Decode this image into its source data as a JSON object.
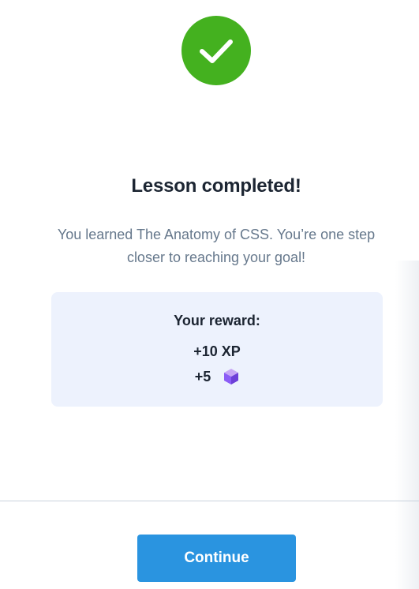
{
  "header": {
    "icon": "checkmark-icon",
    "accent_color": "#44b11f"
  },
  "main": {
    "title": "Lesson completed!",
    "message": "You learned The Anatomy of CSS. You’re one step closer to reaching your goal!"
  },
  "reward": {
    "title": "Your reward:",
    "xp": "+10 XP",
    "gems": "+5",
    "gem_icon": "purple-gem-icon",
    "gem_color": "#9b6ae6"
  },
  "footer": {
    "continue_label": "Continue",
    "button_color": "#2a94e0"
  }
}
